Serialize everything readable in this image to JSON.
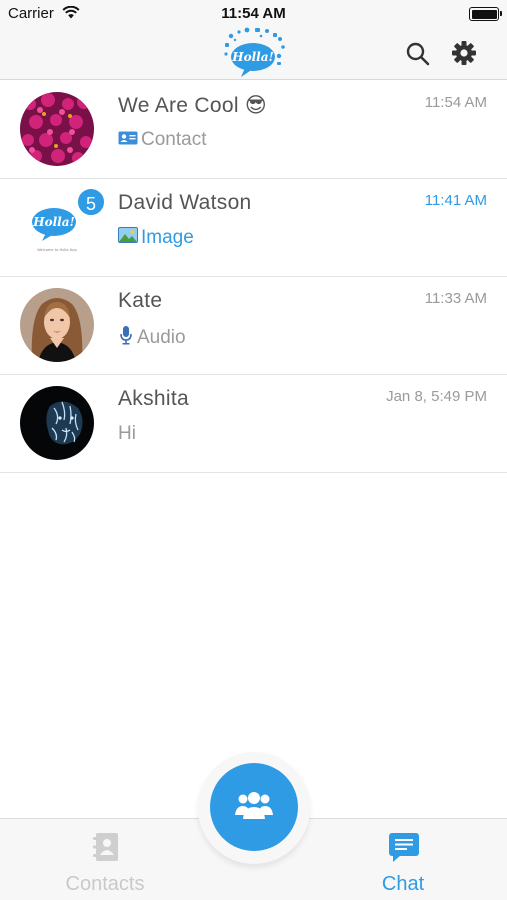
{
  "status_bar": {
    "carrier": "Carrier",
    "time": "11:54 AM"
  },
  "nav": {
    "logo_text": "Holla!",
    "accent_color": "#2f9be4"
  },
  "chats": [
    {
      "name": "We Are Cool 😎",
      "time": "11:54 AM",
      "preview": "Contact",
      "preview_icon": "contact-card-icon",
      "unread_count": null,
      "unread": false
    },
    {
      "name": "David Watson",
      "time": "11:41 AM",
      "preview": "Image",
      "preview_icon": "image-icon",
      "unread_count": "5",
      "unread": true,
      "avatar_logo_text": "Holla!",
      "avatar_caption": "Welcome to Holla App"
    },
    {
      "name": "Kate",
      "time": "11:33 AM",
      "preview": "Audio",
      "preview_icon": "microphone-icon",
      "unread_count": null,
      "unread": false
    },
    {
      "name": "Akshita",
      "time": "Jan 8, 5:49 PM",
      "preview": "Hi",
      "preview_icon": null,
      "unread_count": null,
      "unread": false
    }
  ],
  "tabs": [
    {
      "label": "Contacts",
      "icon": "contacts-book-icon",
      "active": false
    },
    {
      "label": "Chat",
      "icon": "chat-bubble-icon",
      "active": true
    }
  ],
  "fab": {
    "icon": "group-icon"
  }
}
